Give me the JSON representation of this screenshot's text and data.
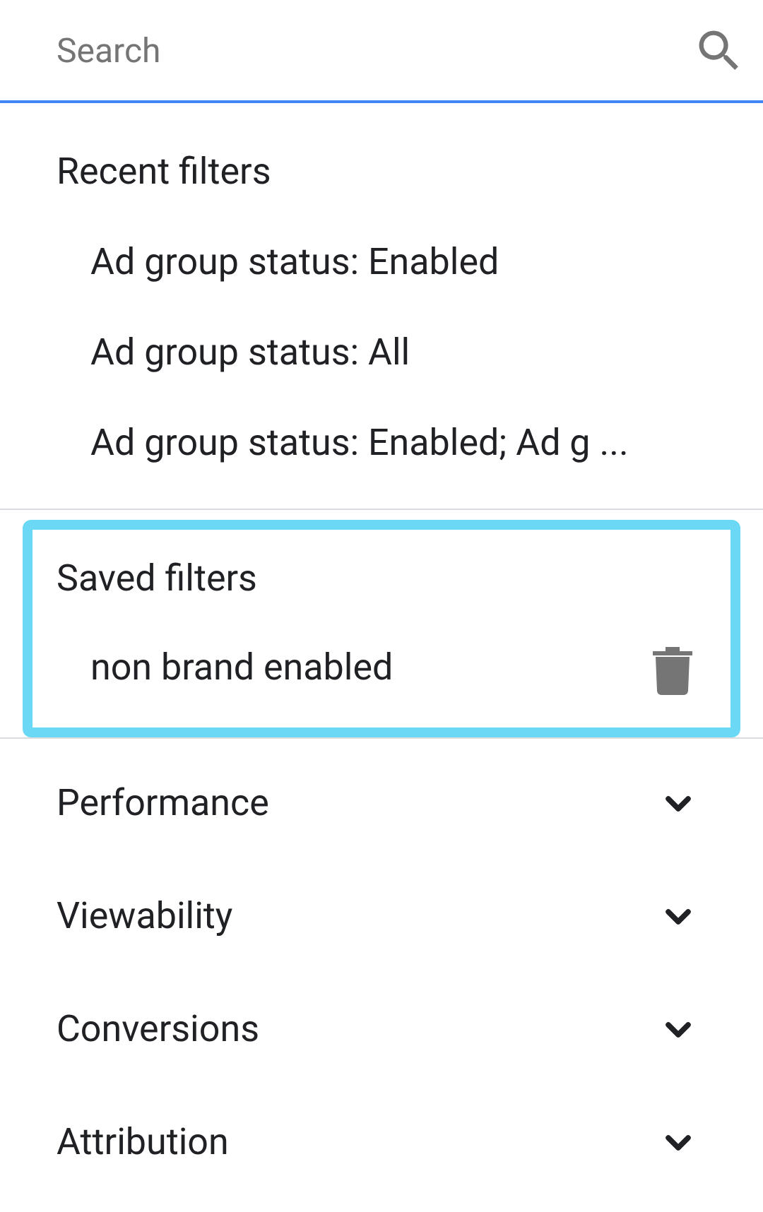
{
  "search": {
    "placeholder": "Search"
  },
  "recent_filters": {
    "title": "Recent filters",
    "items": [
      {
        "label": "Ad group status: Enabled"
      },
      {
        "label": "Ad group status: All"
      },
      {
        "label": "Ad group status: Enabled; Ad g ..."
      }
    ]
  },
  "saved_filters": {
    "title": "Saved filters",
    "highlighted": true,
    "items": [
      {
        "label": "non brand enabled"
      }
    ]
  },
  "sections": [
    {
      "label": "Performance",
      "expanded": false
    },
    {
      "label": "Viewability",
      "expanded": false
    },
    {
      "label": "Conversions",
      "expanded": false
    },
    {
      "label": "Attribution",
      "expanded": false
    }
  ]
}
